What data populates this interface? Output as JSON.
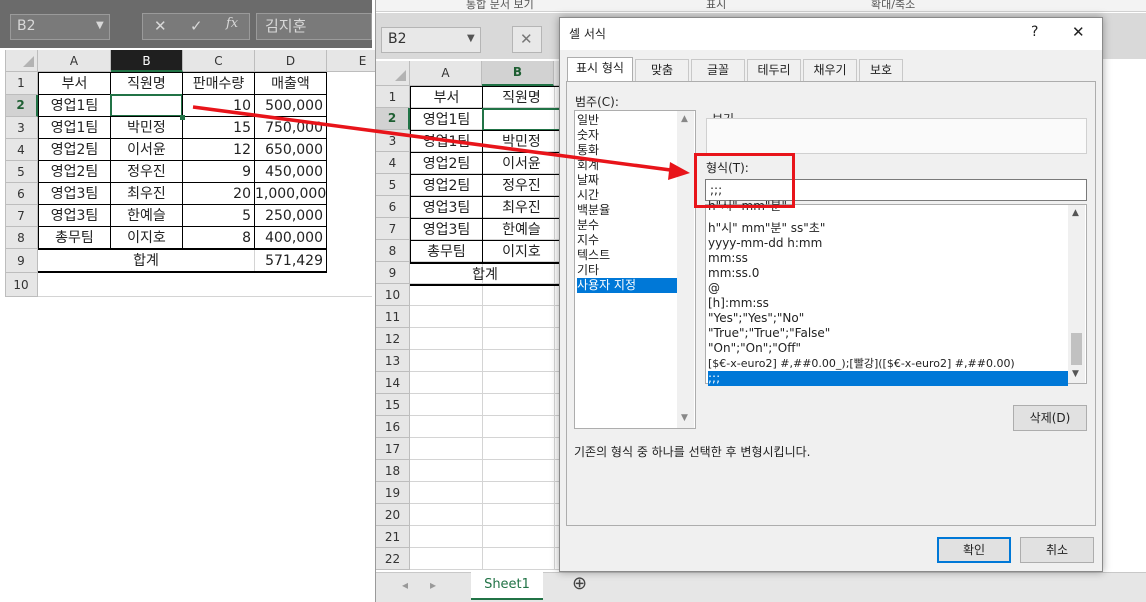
{
  "left": {
    "namebox": "B2",
    "formula_value": "김지훈",
    "fx": "fx",
    "cancel_symbol": "✕",
    "enter_symbol": "✓",
    "columns": [
      "A",
      "B",
      "C",
      "D",
      "E"
    ],
    "rows": [
      "1",
      "2",
      "3",
      "4",
      "5",
      "6",
      "7",
      "8",
      "9",
      "10"
    ],
    "table": [
      [
        "부서",
        "직원명",
        "판매수량",
        "매출액"
      ],
      [
        "영업1팀",
        "",
        "10",
        "500,000"
      ],
      [
        "영업1팀",
        "박민정",
        "15",
        "750,000"
      ],
      [
        "영업2팀",
        "이서윤",
        "12",
        "650,000"
      ],
      [
        "영업2팀",
        "정우진",
        "9",
        "450,000"
      ],
      [
        "영업3팀",
        "최우진",
        "20",
        "1,000,000"
      ],
      [
        "영업3팀",
        "한예슬",
        "5",
        "250,000"
      ],
      [
        "총무팀",
        "이지호",
        "8",
        "400,000"
      ]
    ],
    "total_label": "합계",
    "total_value": "571,429"
  },
  "right": {
    "ribbon_labels": [
      "통합 문서 보기",
      "표시",
      "확대/축소"
    ],
    "namebox": "B2",
    "columns": [
      "A",
      "B"
    ],
    "rows": [
      "1",
      "2",
      "3",
      "4",
      "5",
      "6",
      "7",
      "8",
      "9",
      "10",
      "11",
      "12",
      "13",
      "14",
      "15",
      "16",
      "17",
      "18",
      "19",
      "20",
      "21",
      "22"
    ],
    "table": [
      [
        "부서",
        "직원명"
      ],
      [
        "영업1팀",
        ""
      ],
      [
        "영업1팀",
        "박민정"
      ],
      [
        "영업2팀",
        "이서윤"
      ],
      [
        "영업2팀",
        "정우진"
      ],
      [
        "영업3팀",
        "최우진"
      ],
      [
        "영업3팀",
        "한예슬"
      ],
      [
        "총무팀",
        "이지호"
      ]
    ],
    "total_label": "합계",
    "sheet_tab": "Sheet1",
    "add_sheet": "⊕",
    "nav_prev": "◂",
    "nav_next": "▸"
  },
  "dialog": {
    "title": "셀 서식",
    "help": "?",
    "close": "✕",
    "tabs": [
      "표시 형식",
      "맞춤",
      "글꼴",
      "테두리",
      "채우기",
      "보호"
    ],
    "category_label": "범주(C):",
    "categories": [
      "일반",
      "숫자",
      "통화",
      "회계",
      "날짜",
      "시간",
      "백분율",
      "분수",
      "지수",
      "텍스트",
      "기타",
      "사용자 지정"
    ],
    "selected_category": "사용자 지정",
    "preview_label": "보기",
    "format_label": "형식(T):",
    "format_value": ";;;",
    "format_list": [
      "h\"시\" mm\"분\"",
      "h\"시\" mm\"분\" ss\"초\"",
      "yyyy-mm-dd h:mm",
      "mm:ss",
      "mm:ss.0",
      "@",
      "[h]:mm:ss",
      "\"Yes\";\"Yes\";\"No\"",
      "\"True\";\"True\";\"False\"",
      "\"On\";\"On\";\"Off\"",
      "[$€-x-euro2] #,##0.00_);[빨강]([$€-x-euro2] #,##0.00)",
      ";;;"
    ],
    "delete_button": "삭제(D)",
    "description": "기존의 형식 중 하나를 선택한 후 변형시킵니다.",
    "ok_button": "확인",
    "cancel_button": "취소"
  },
  "colors": {
    "excel_green": "#217346",
    "highlight_red": "#e8141a",
    "selection_blue": "#0078d7"
  }
}
